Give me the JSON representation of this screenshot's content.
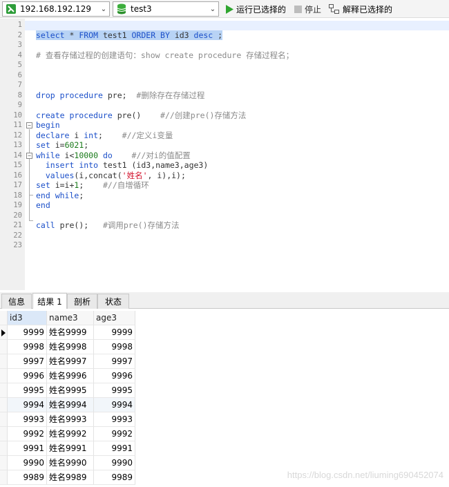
{
  "toolbar": {
    "connection": "192.168.192.129",
    "database": "test3",
    "run_selected": "运行已选择的",
    "stop": "停止",
    "explain_selected": "解释已选择的"
  },
  "editor": {
    "lines": [
      {
        "n": "1",
        "tokens": []
      },
      {
        "n": "2",
        "tokens": [
          {
            "t": "select",
            "c": "kw hl"
          },
          {
            "t": " * ",
            "c": "hl"
          },
          {
            "t": "FROM",
            "c": "kw hl"
          },
          {
            "t": " test1 ",
            "c": "hl"
          },
          {
            "t": "ORDER BY",
            "c": "kw hl"
          },
          {
            "t": " id3 ",
            "c": "hl"
          },
          {
            "t": "desc",
            "c": "kw hl"
          },
          {
            "t": " ;",
            "c": "hl"
          }
        ]
      },
      {
        "n": "3",
        "tokens": []
      },
      {
        "n": "4",
        "tokens": [
          {
            "t": "# 查看存储过程的创建语句：show create procedure 存储过程名；",
            "c": "cm"
          }
        ]
      },
      {
        "n": "5",
        "tokens": []
      },
      {
        "n": "6",
        "tokens": []
      },
      {
        "n": "7",
        "tokens": []
      },
      {
        "n": "8",
        "tokens": [
          {
            "t": "drop procedure",
            "c": "kw"
          },
          {
            "t": " pre;  ",
            "c": "fn"
          },
          {
            "t": "#删除存在存储过程",
            "c": "cm"
          }
        ]
      },
      {
        "n": "9",
        "tokens": []
      },
      {
        "n": "10",
        "tokens": [
          {
            "t": "create procedure",
            "c": "kw"
          },
          {
            "t": " pre()    ",
            "c": "fn"
          },
          {
            "t": "#//创建pre()存储方法",
            "c": "cm"
          }
        ]
      },
      {
        "n": "11",
        "tokens": [
          {
            "t": "begin",
            "c": "kw"
          }
        ]
      },
      {
        "n": "12",
        "tokens": [
          {
            "t": "declare",
            "c": "kw"
          },
          {
            "t": " i ",
            "c": "fn"
          },
          {
            "t": "int",
            "c": "kw"
          },
          {
            "t": ";    ",
            "c": "fn"
          },
          {
            "t": "#//定义i变量",
            "c": "cm"
          }
        ]
      },
      {
        "n": "13",
        "tokens": [
          {
            "t": "set",
            "c": "kw"
          },
          {
            "t": " i=",
            "c": "fn"
          },
          {
            "t": "6021",
            "c": "nm"
          },
          {
            "t": ";",
            "c": "fn"
          }
        ]
      },
      {
        "n": "14",
        "tokens": [
          {
            "t": "while",
            "c": "kw"
          },
          {
            "t": " i<",
            "c": "fn"
          },
          {
            "t": "10000",
            "c": "nm"
          },
          {
            "t": " ",
            "c": "fn"
          },
          {
            "t": "do",
            "c": "kw"
          },
          {
            "t": "    ",
            "c": "fn"
          },
          {
            "t": "#//对i的值配置",
            "c": "cm"
          }
        ]
      },
      {
        "n": "15",
        "tokens": [
          {
            "t": "  ",
            "c": "fn"
          },
          {
            "t": "insert into",
            "c": "kw"
          },
          {
            "t": " test1 (id3,name3,age3)",
            "c": "fn"
          }
        ]
      },
      {
        "n": "16",
        "tokens": [
          {
            "t": "  ",
            "c": "fn"
          },
          {
            "t": "values",
            "c": "kw"
          },
          {
            "t": "(i,concat(",
            "c": "fn"
          },
          {
            "t": "'姓名'",
            "c": "st"
          },
          {
            "t": ", i),i);",
            "c": "fn"
          }
        ]
      },
      {
        "n": "17",
        "tokens": [
          {
            "t": "set",
            "c": "kw"
          },
          {
            "t": " i=i+",
            "c": "fn"
          },
          {
            "t": "1",
            "c": "nm"
          },
          {
            "t": ";    ",
            "c": "fn"
          },
          {
            "t": "#//自增循环",
            "c": "cm"
          }
        ]
      },
      {
        "n": "18",
        "tokens": [
          {
            "t": "end while",
            "c": "kw"
          },
          {
            "t": ";",
            "c": "fn"
          }
        ]
      },
      {
        "n": "19",
        "tokens": [
          {
            "t": "end",
            "c": "kw"
          }
        ]
      },
      {
        "n": "20",
        "tokens": []
      },
      {
        "n": "21",
        "tokens": [
          {
            "t": "call",
            "c": "kw"
          },
          {
            "t": " pre();   ",
            "c": "fn"
          },
          {
            "t": "#调用pre()存储方法",
            "c": "cm"
          }
        ]
      },
      {
        "n": "22",
        "tokens": []
      },
      {
        "n": "23",
        "tokens": []
      }
    ]
  },
  "tabs": [
    {
      "label": "信息",
      "active": false
    },
    {
      "label": "结果 1",
      "active": true
    },
    {
      "label": "剖析",
      "active": false
    },
    {
      "label": "状态",
      "active": false
    }
  ],
  "grid": {
    "columns": [
      "id3",
      "name3",
      "age3"
    ],
    "rows": [
      [
        "9999",
        "姓名9999",
        "9999"
      ],
      [
        "9998",
        "姓名9998",
        "9998"
      ],
      [
        "9997",
        "姓名9997",
        "9997"
      ],
      [
        "9996",
        "姓名9996",
        "9996"
      ],
      [
        "9995",
        "姓名9995",
        "9995"
      ],
      [
        "9994",
        "姓名9994",
        "9994"
      ],
      [
        "9993",
        "姓名9993",
        "9993"
      ],
      [
        "9992",
        "姓名9992",
        "9992"
      ],
      [
        "9991",
        "姓名9991",
        "9991"
      ],
      [
        "9990",
        "姓名9990",
        "9990"
      ],
      [
        "9989",
        "姓名9989",
        "9989"
      ]
    ]
  },
  "watermark": "https://blog.csdn.net/liuming690452074",
  "icons": {
    "connection": "connection-icon",
    "database": "database-icon",
    "run": "play-icon",
    "stop": "stop-icon",
    "explain": "explain-icon"
  }
}
